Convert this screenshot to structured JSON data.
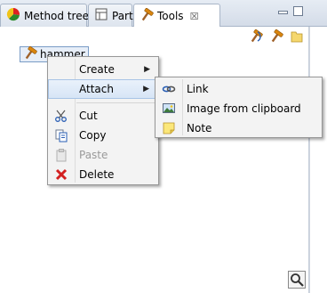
{
  "tabs": [
    {
      "label": "Method tree",
      "icon": "method-tree-icon"
    },
    {
      "label": "Parts",
      "icon": "parts-icon"
    },
    {
      "label": "Tools",
      "icon": "hammer-icon",
      "close": "☒"
    }
  ],
  "toolbar": {
    "icons": [
      "paint-hammer-icon",
      "hammer-icon",
      "folder-icon"
    ]
  },
  "tree": {
    "node_label": "hammer"
  },
  "context_menu": {
    "items": [
      {
        "label": "Create",
        "submenu": true
      },
      {
        "label": "Attach",
        "submenu": true,
        "highlighted": true
      },
      {
        "label": "Cut",
        "icon": "scissors-icon"
      },
      {
        "label": "Copy",
        "icon": "copy-icon"
      },
      {
        "label": "Paste",
        "icon": "paste-icon",
        "disabled": true
      },
      {
        "label": "Delete",
        "icon": "delete-icon"
      }
    ]
  },
  "submenu": {
    "items": [
      {
        "label": "Link",
        "icon": "link-icon"
      },
      {
        "label": "Image from clipboard",
        "icon": "image-icon"
      },
      {
        "label": "Note",
        "icon": "note-icon"
      }
    ]
  },
  "colors": {
    "accent": "#d7e5f6",
    "delete_red": "#d32020",
    "hammer_orange": "#d9850f"
  }
}
